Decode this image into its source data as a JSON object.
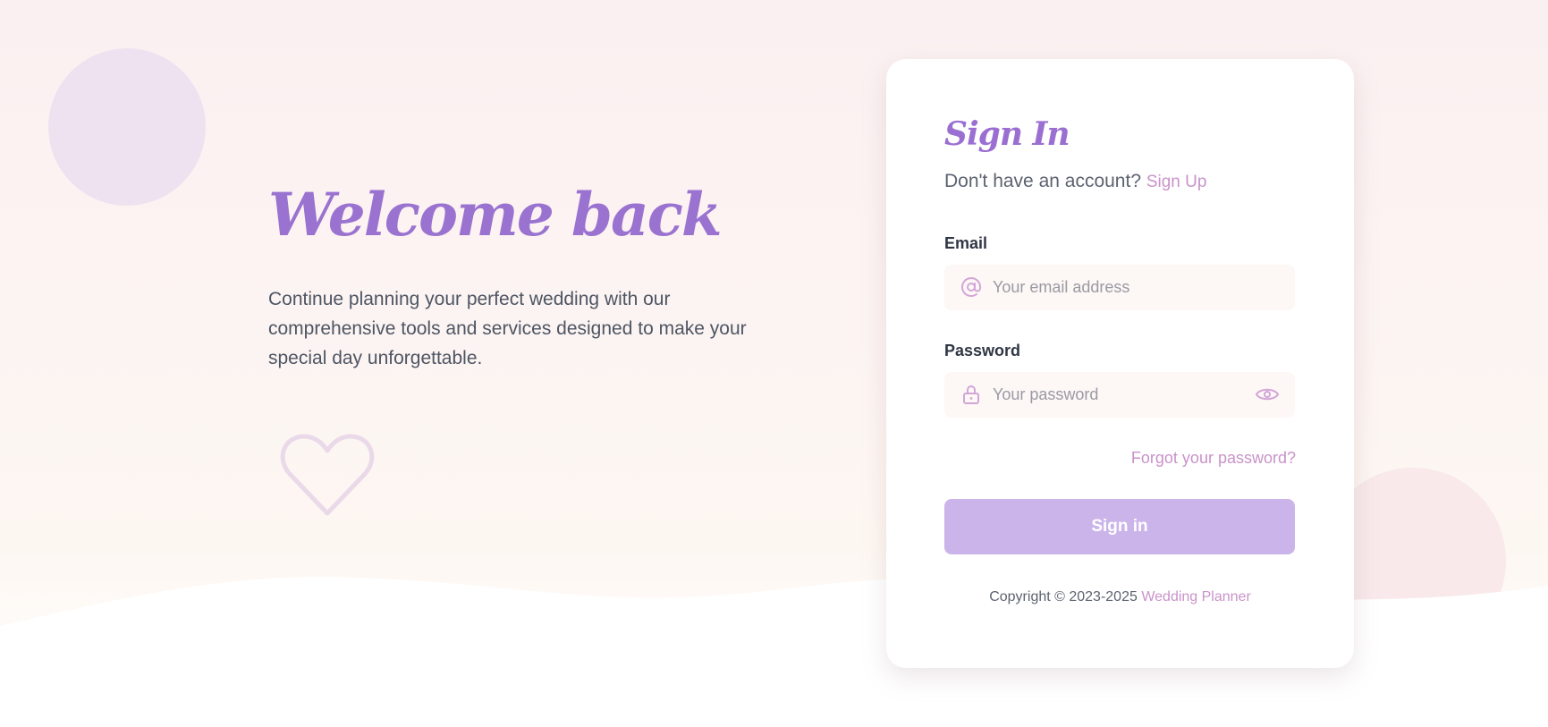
{
  "hero": {
    "title": "Welcome back",
    "description": "Continue planning your perfect wedding with our comprehensive tools and services designed to make your special day unforgettable."
  },
  "signin": {
    "title": "Sign In",
    "prompt": "Don't have an account?",
    "signup_link": "Sign Up",
    "email_label": "Email",
    "email_placeholder": "Your email address",
    "password_label": "Password",
    "password_placeholder": "Your password",
    "forgot_link": "Forgot your password?",
    "submit_label": "Sign in"
  },
  "footer": {
    "copyright": "Copyright © 2023-2025",
    "brand": "Wedding Planner"
  },
  "icons": {
    "email": "at-icon",
    "password": "lock-icon",
    "toggle": "eye-icon",
    "decoration": "heart-icon"
  },
  "colors": {
    "accent_purple": "#9a72d0",
    "link_pink": "#c993c9",
    "button": "#cbb4ea",
    "field_bg": "#fdf7f5"
  }
}
